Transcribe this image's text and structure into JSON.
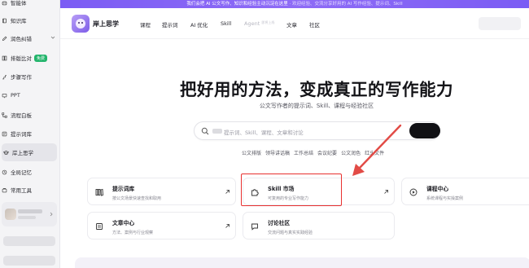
{
  "banner": {
    "text": "我们会把 AI 公文写作、知识和经验主动沉淀在这里",
    "subtext": "· 欢迎经验、交流分享好用的 AI 写作经验、提示词、Skill"
  },
  "sidebar": {
    "items": [
      {
        "label": "智能体",
        "icon": "bot-icon"
      },
      {
        "label": "知识库",
        "icon": "book-icon"
      },
      {
        "label": "润色纠错",
        "icon": "pen-icon",
        "has_chevron": true
      },
      {
        "label": "排版比对",
        "icon": "layout-icon",
        "badge": "免费"
      },
      {
        "label": "步骤写作",
        "icon": "steps-icon"
      },
      {
        "label": "PPT",
        "icon": "slides-icon"
      },
      {
        "label": "流程白板",
        "icon": "flow-icon"
      },
      {
        "label": "提示词库",
        "icon": "prompt-icon"
      },
      {
        "label": "岸上思学",
        "icon": "cap-icon",
        "active": true
      },
      {
        "label": "全局记忆",
        "icon": "memory-icon"
      },
      {
        "label": "常用工具",
        "icon": "tool-icon"
      }
    ]
  },
  "header": {
    "brand": "岸上思学",
    "nav": [
      {
        "label": "课程"
      },
      {
        "label": "提示词"
      },
      {
        "label": "AI 优化"
      },
      {
        "label": "Skill"
      },
      {
        "label": "Agent",
        "sup": "即将上线",
        "muted": true
      },
      {
        "label": "文章"
      },
      {
        "label": "社区"
      }
    ]
  },
  "hero": {
    "title": "把好用的方法，变成真正的写作能力",
    "subtitle": "公文写作者的提示词、Skill、课程与经验社区"
  },
  "search": {
    "placeholder": "提示词、Skill、课程、文章和讨论"
  },
  "tags": [
    "公文排版",
    "领导讲话稿",
    "工作总结",
    "会议纪要",
    "公文润色",
    "红头文件"
  ],
  "cards": [
    {
      "title": "提示词库",
      "desc": "按公文场景快速查找和取用",
      "icon": "library-icon"
    },
    {
      "title": "Skill 市场",
      "desc": "可复用的专业写作能力",
      "icon": "puzzle-icon"
    },
    {
      "title": "课程中心",
      "desc": "系统课程与实操案例",
      "icon": "play-icon"
    },
    {
      "title": "文章中心",
      "desc": "方法、案例与行业观察",
      "icon": "article-icon"
    },
    {
      "title": "讨论社区",
      "desc": "交流问题与真实实践经验",
      "icon": "chat-icon"
    }
  ],
  "colors": {
    "banner": "#7b5cf4",
    "highlight_box": "#e8302f",
    "annotation_arrow": "#e24b46",
    "badge_free": "#22b46b",
    "search_button": "#111115"
  }
}
